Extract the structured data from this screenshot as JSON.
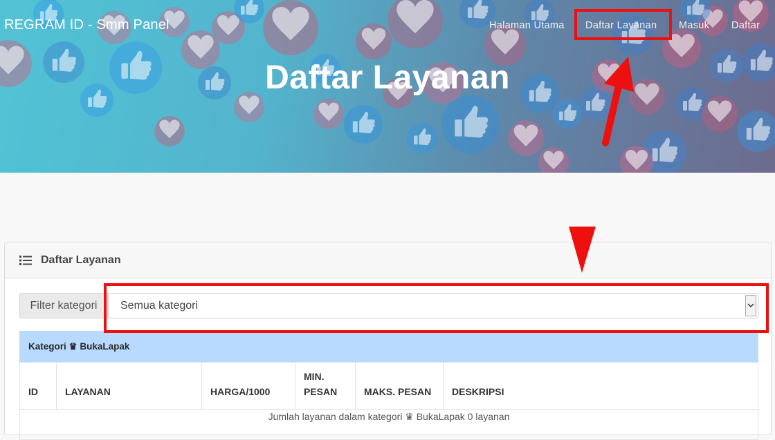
{
  "brand": "REGRAM ID - Smm Panel",
  "nav": [
    {
      "label": "Halaman Utama"
    },
    {
      "label": "Daftar Layanan"
    },
    {
      "label": "Masuk"
    },
    {
      "label": "Daftar"
    }
  ],
  "hero": {
    "title": "Daftar Layanan"
  },
  "card": {
    "title": "Daftar Layanan",
    "filter_label": "Filter kategori",
    "select_value": "Semua kategori",
    "category_title": "Kategori ♛ BukaLapak",
    "columns": [
      "ID",
      "LAYANAN",
      "HARGA/1000",
      "MIN. PESAN",
      "MAKS. PESAN",
      "DESKRIPSI"
    ],
    "summary": "Jumlah layanan dalam kategori ♛ BukaLapak 0 layanan"
  },
  "colors": {
    "annotation": "#ee0f0f",
    "category_bg": "#b8daff",
    "hero_start": "#52c3d5",
    "hero_end": "#6d6b8e"
  },
  "icons": [
    "list-icon",
    "chevron-down-icon",
    "heart-icon",
    "thumbs-up-icon"
  ]
}
